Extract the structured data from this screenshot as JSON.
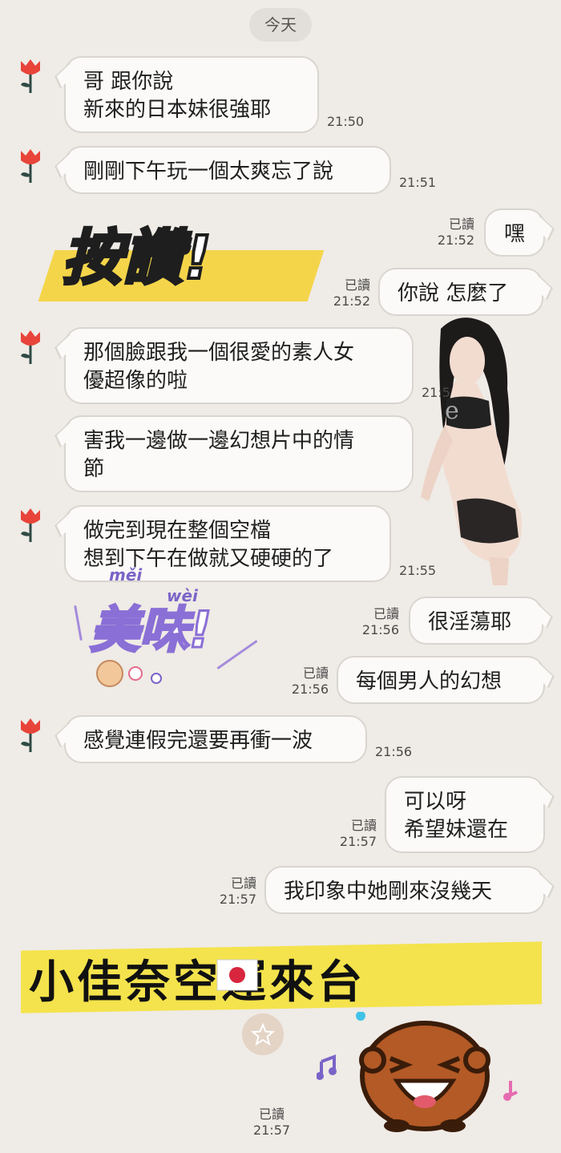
{
  "date_chip": "今天",
  "messages": [
    {
      "dir": "in",
      "text": "哥 跟你說\n新來的日本妹很強耶",
      "time": "21:50"
    },
    {
      "dir": "in",
      "text": "剛剛下午玩一個太爽忘了說",
      "time": "21:51"
    },
    {
      "dir": "out",
      "text": "嘿",
      "read": "已讀",
      "time": "21:52"
    },
    {
      "dir": "out",
      "text": "你說 怎麼了",
      "read": "已讀",
      "time": "21:52"
    },
    {
      "dir": "in",
      "text": "那個臉跟我一個很愛的素人女\n優超像的啦",
      "time": "21:5"
    },
    {
      "dir": "in",
      "text": "害我一邊做一邊幻想片中的情\n節"
    },
    {
      "dir": "in",
      "text": "做完到現在整個空檔\n想到下午在做就又硬硬的了",
      "time": "21:55"
    },
    {
      "dir": "out",
      "text": "很淫蕩耶",
      "read": "已讀",
      "time": "21:56"
    },
    {
      "dir": "out",
      "text": "每個男人的幻想",
      "read": "已讀",
      "time": "21:56"
    },
    {
      "dir": "in",
      "text": "感覺連假完還要再衝一波",
      "time": "21:56"
    },
    {
      "dir": "out",
      "text": "可以呀\n希望妹還在",
      "read": "已讀",
      "time": "21:57"
    },
    {
      "dir": "out",
      "text": "我印象中她剛來沒幾天",
      "read": "已讀",
      "time": "21:57"
    }
  ],
  "stickers": {
    "like": "按讚!",
    "yummy": "美味!",
    "yummy_pinyin_1": "měi",
    "yummy_pinyin_2": "wèi",
    "banner": "小佳奈空運來台",
    "photo_watermark": "e"
  },
  "last_sticker_read": "已讀",
  "last_sticker_time": "21:57",
  "icons": {
    "avatar": "tulip-icon",
    "star": "star-icon",
    "flag": "japan-flag-icon",
    "note": "music-note-icon"
  }
}
